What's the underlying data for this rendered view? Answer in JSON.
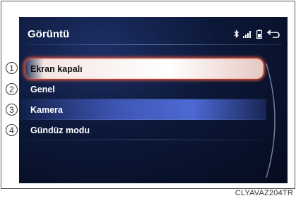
{
  "screen": {
    "title": "Görüntü",
    "status_icons": [
      "bluetooth-icon",
      "signal-strength-icon",
      "battery-icon",
      "back-icon"
    ]
  },
  "menu": {
    "items": [
      {
        "number": "1",
        "label": "Ekran kapalı",
        "state": "selected"
      },
      {
        "number": "2",
        "label": "Genel",
        "state": "normal"
      },
      {
        "number": "3",
        "label": "Kamera",
        "state": "highlight"
      },
      {
        "number": "4",
        "label": "Gündüz modu",
        "state": "normal"
      }
    ]
  },
  "caption": "CLYAVAZ204TR",
  "colors": {
    "screen_bg": "#0c1838",
    "selected_glow": "#ff5a3c",
    "highlight_band": "#4660c8"
  }
}
